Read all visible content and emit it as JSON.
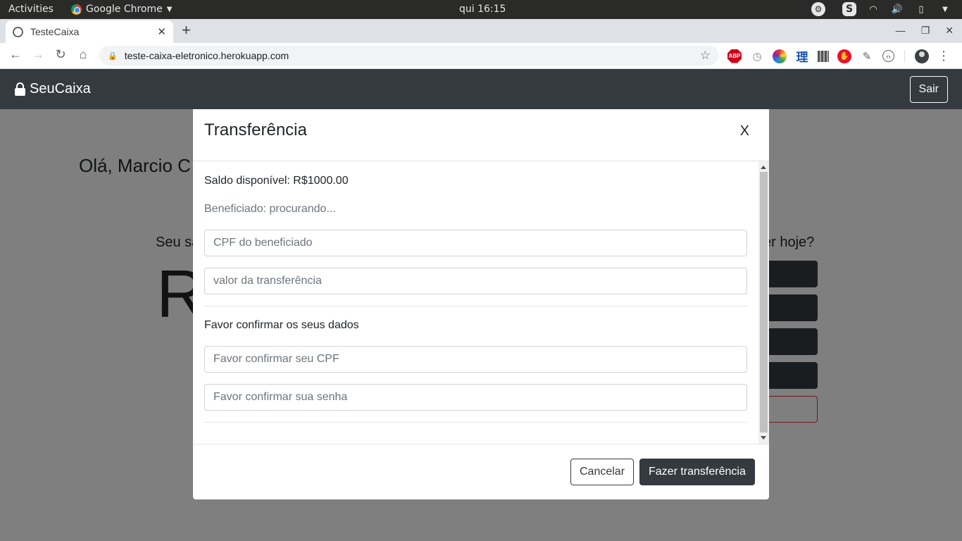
{
  "system_bar": {
    "activities": "Activities",
    "app_name": "Google Chrome",
    "clock": "qui 16:15"
  },
  "browser": {
    "tab_title": "TesteCaixa",
    "url": "teste-caixa-eletronico.herokuapp.com",
    "ext_abp": "ABP",
    "ext_kanji": "理"
  },
  "app": {
    "brand": "SeuCaixa",
    "logout_label": "Sair",
    "greeting": "Olá, Marcio C",
    "balance_label": "Seu sa",
    "balance_value": "R",
    "question_suffix": "er hoje?"
  },
  "modal": {
    "title": "Transferência",
    "close_label": "X",
    "saldo_text": "Saldo disponível: R$1000.00",
    "beneficiado_text": "Beneficiado: procurando...",
    "cpf_beneficiado_placeholder": "CPF do beneficiado",
    "valor_placeholder": "valor da transferência",
    "confirm_label": "Favor confirmar os seus dados",
    "confirm_cpf_placeholder": "Favor confirmar seu CPF",
    "confirm_senha_placeholder": "Favor confirmar sua senha",
    "cancel_label": "Cancelar",
    "submit_label": "Fazer transferência"
  }
}
